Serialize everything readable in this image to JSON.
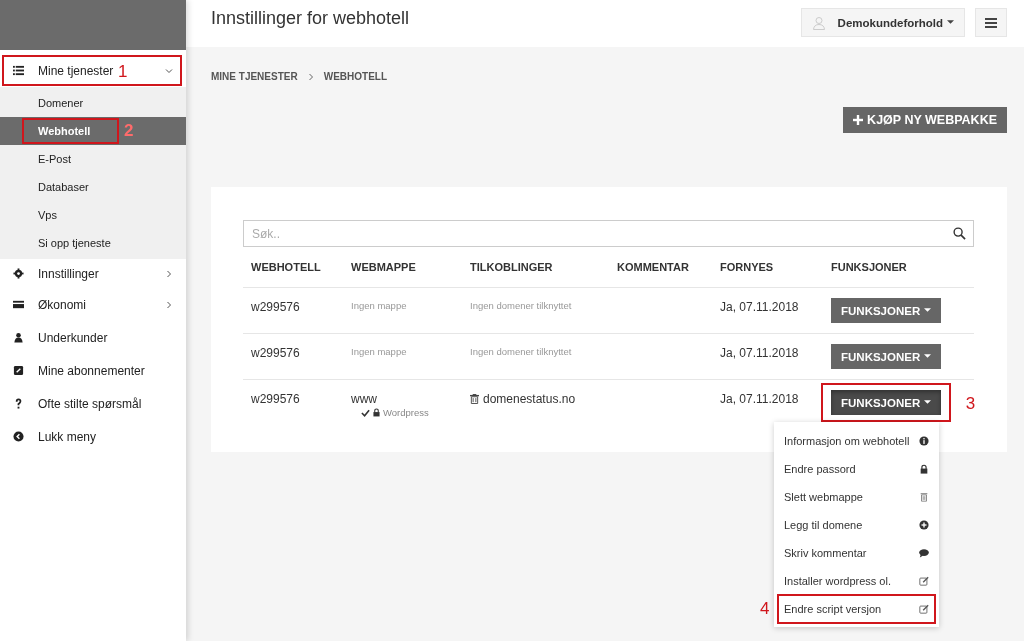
{
  "header": {
    "title": "Innstillinger for webhotell",
    "account": "Demokundeforhold"
  },
  "sidebar": {
    "items": [
      {
        "label": "Mine tjenester",
        "expanded": true,
        "callout": "1",
        "children": [
          {
            "label": "Domener",
            "selected": false
          },
          {
            "label": "Webhotell",
            "selected": true,
            "callout": "2"
          },
          {
            "label": "E-Post",
            "selected": false
          },
          {
            "label": "Databaser",
            "selected": false
          },
          {
            "label": "Vps",
            "selected": false
          },
          {
            "label": "Si opp tjeneste",
            "selected": false
          }
        ]
      },
      {
        "label": "Innstillinger",
        "expanded": false
      },
      {
        "label": "Økonomi",
        "expanded": false
      },
      {
        "label": "Underkunder"
      },
      {
        "label": "Mine abonnementer"
      },
      {
        "label": "Ofte stilte spørsmål"
      },
      {
        "label": "Lukk meny"
      }
    ]
  },
  "breadcrumb": [
    "MINE TJENESTER",
    "WEBHOTELL"
  ],
  "buy_button": "KJØP NY WEBPAKKE",
  "search": {
    "placeholder": "Søk.."
  },
  "table": {
    "columns": [
      "WEBHOTELL",
      "WEBMAPPE",
      "TILKOBLINGER",
      "KOMMENTAR",
      "FORNYES",
      "FUNKSJONER"
    ],
    "rows": [
      {
        "webhotell": "w299576",
        "folder": {
          "text": "Ingen mappe",
          "assigned": false
        },
        "connection": {
          "text": "Ingen domener tilknyttet",
          "assigned": false
        },
        "renews": "Ja, 07.11.2018",
        "button": "FUNKSJONER",
        "open": false
      },
      {
        "webhotell": "w299576",
        "folder": {
          "text": "Ingen mappe",
          "assigned": false
        },
        "connection": {
          "text": "Ingen domener tilknyttet",
          "assigned": false
        },
        "renews": "Ja, 07.11.2018",
        "button": "FUNKSJONER",
        "open": false
      },
      {
        "webhotell": "w299576",
        "folder": {
          "text": "www",
          "assigned": true,
          "app": "Wordpress"
        },
        "connection": {
          "text": "domenestatus.no",
          "assigned": true
        },
        "renews": "Ja, 07.11.2018",
        "button": "FUNKSJONER",
        "open": true,
        "callout": "3"
      }
    ]
  },
  "menu": {
    "items": [
      {
        "label": "Informasjon om webhotell"
      },
      {
        "label": "Endre passord"
      },
      {
        "label": "Slett webmappe"
      },
      {
        "label": "Legg til domene"
      },
      {
        "label": "Skriv kommentar"
      },
      {
        "label": "Installer wordpress ol."
      },
      {
        "label": "Endre script versjon",
        "callout": "4"
      }
    ]
  }
}
